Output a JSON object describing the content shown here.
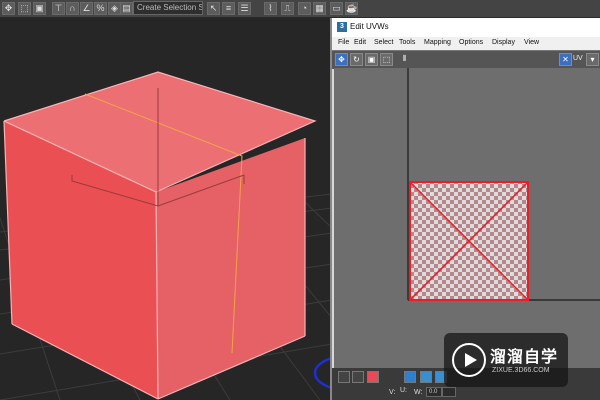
{
  "main_toolbar": {
    "selection_dropdown": "Create Selection Se",
    "icons": [
      "move-icon",
      "scale-icon",
      "cube-icon",
      "align-icon",
      "snap-2d-icon",
      "snap-angle-icon",
      "percent-snap-icon",
      "spinner-snap-icon",
      "named-selection-icon",
      "select-cursor-icon",
      "layers-icon",
      "curve-editor-icon",
      "schematic-icon",
      "material-editor-icon",
      "render-setup-icon",
      "render-frame-icon",
      "render-icon"
    ]
  },
  "uv_window": {
    "title": "Edit UVWs",
    "menu": [
      "File",
      "Edit",
      "Select",
      "Tools",
      "Mapping",
      "Options",
      "Display",
      "View"
    ],
    "toolbar_uv_label": "UV",
    "bottom_u_label": "U:",
    "bottom_v_label": "V:",
    "bottom_w_label": "W:",
    "bottom_w_value": "0.0"
  },
  "watermark": {
    "title": "溜溜自学",
    "url": "ZIXUE.3D66.COM"
  },
  "colors": {
    "cube_face": "#ea6064",
    "uv_selection": "#ee1c24",
    "highlight_circle": "#1f2fd0"
  }
}
